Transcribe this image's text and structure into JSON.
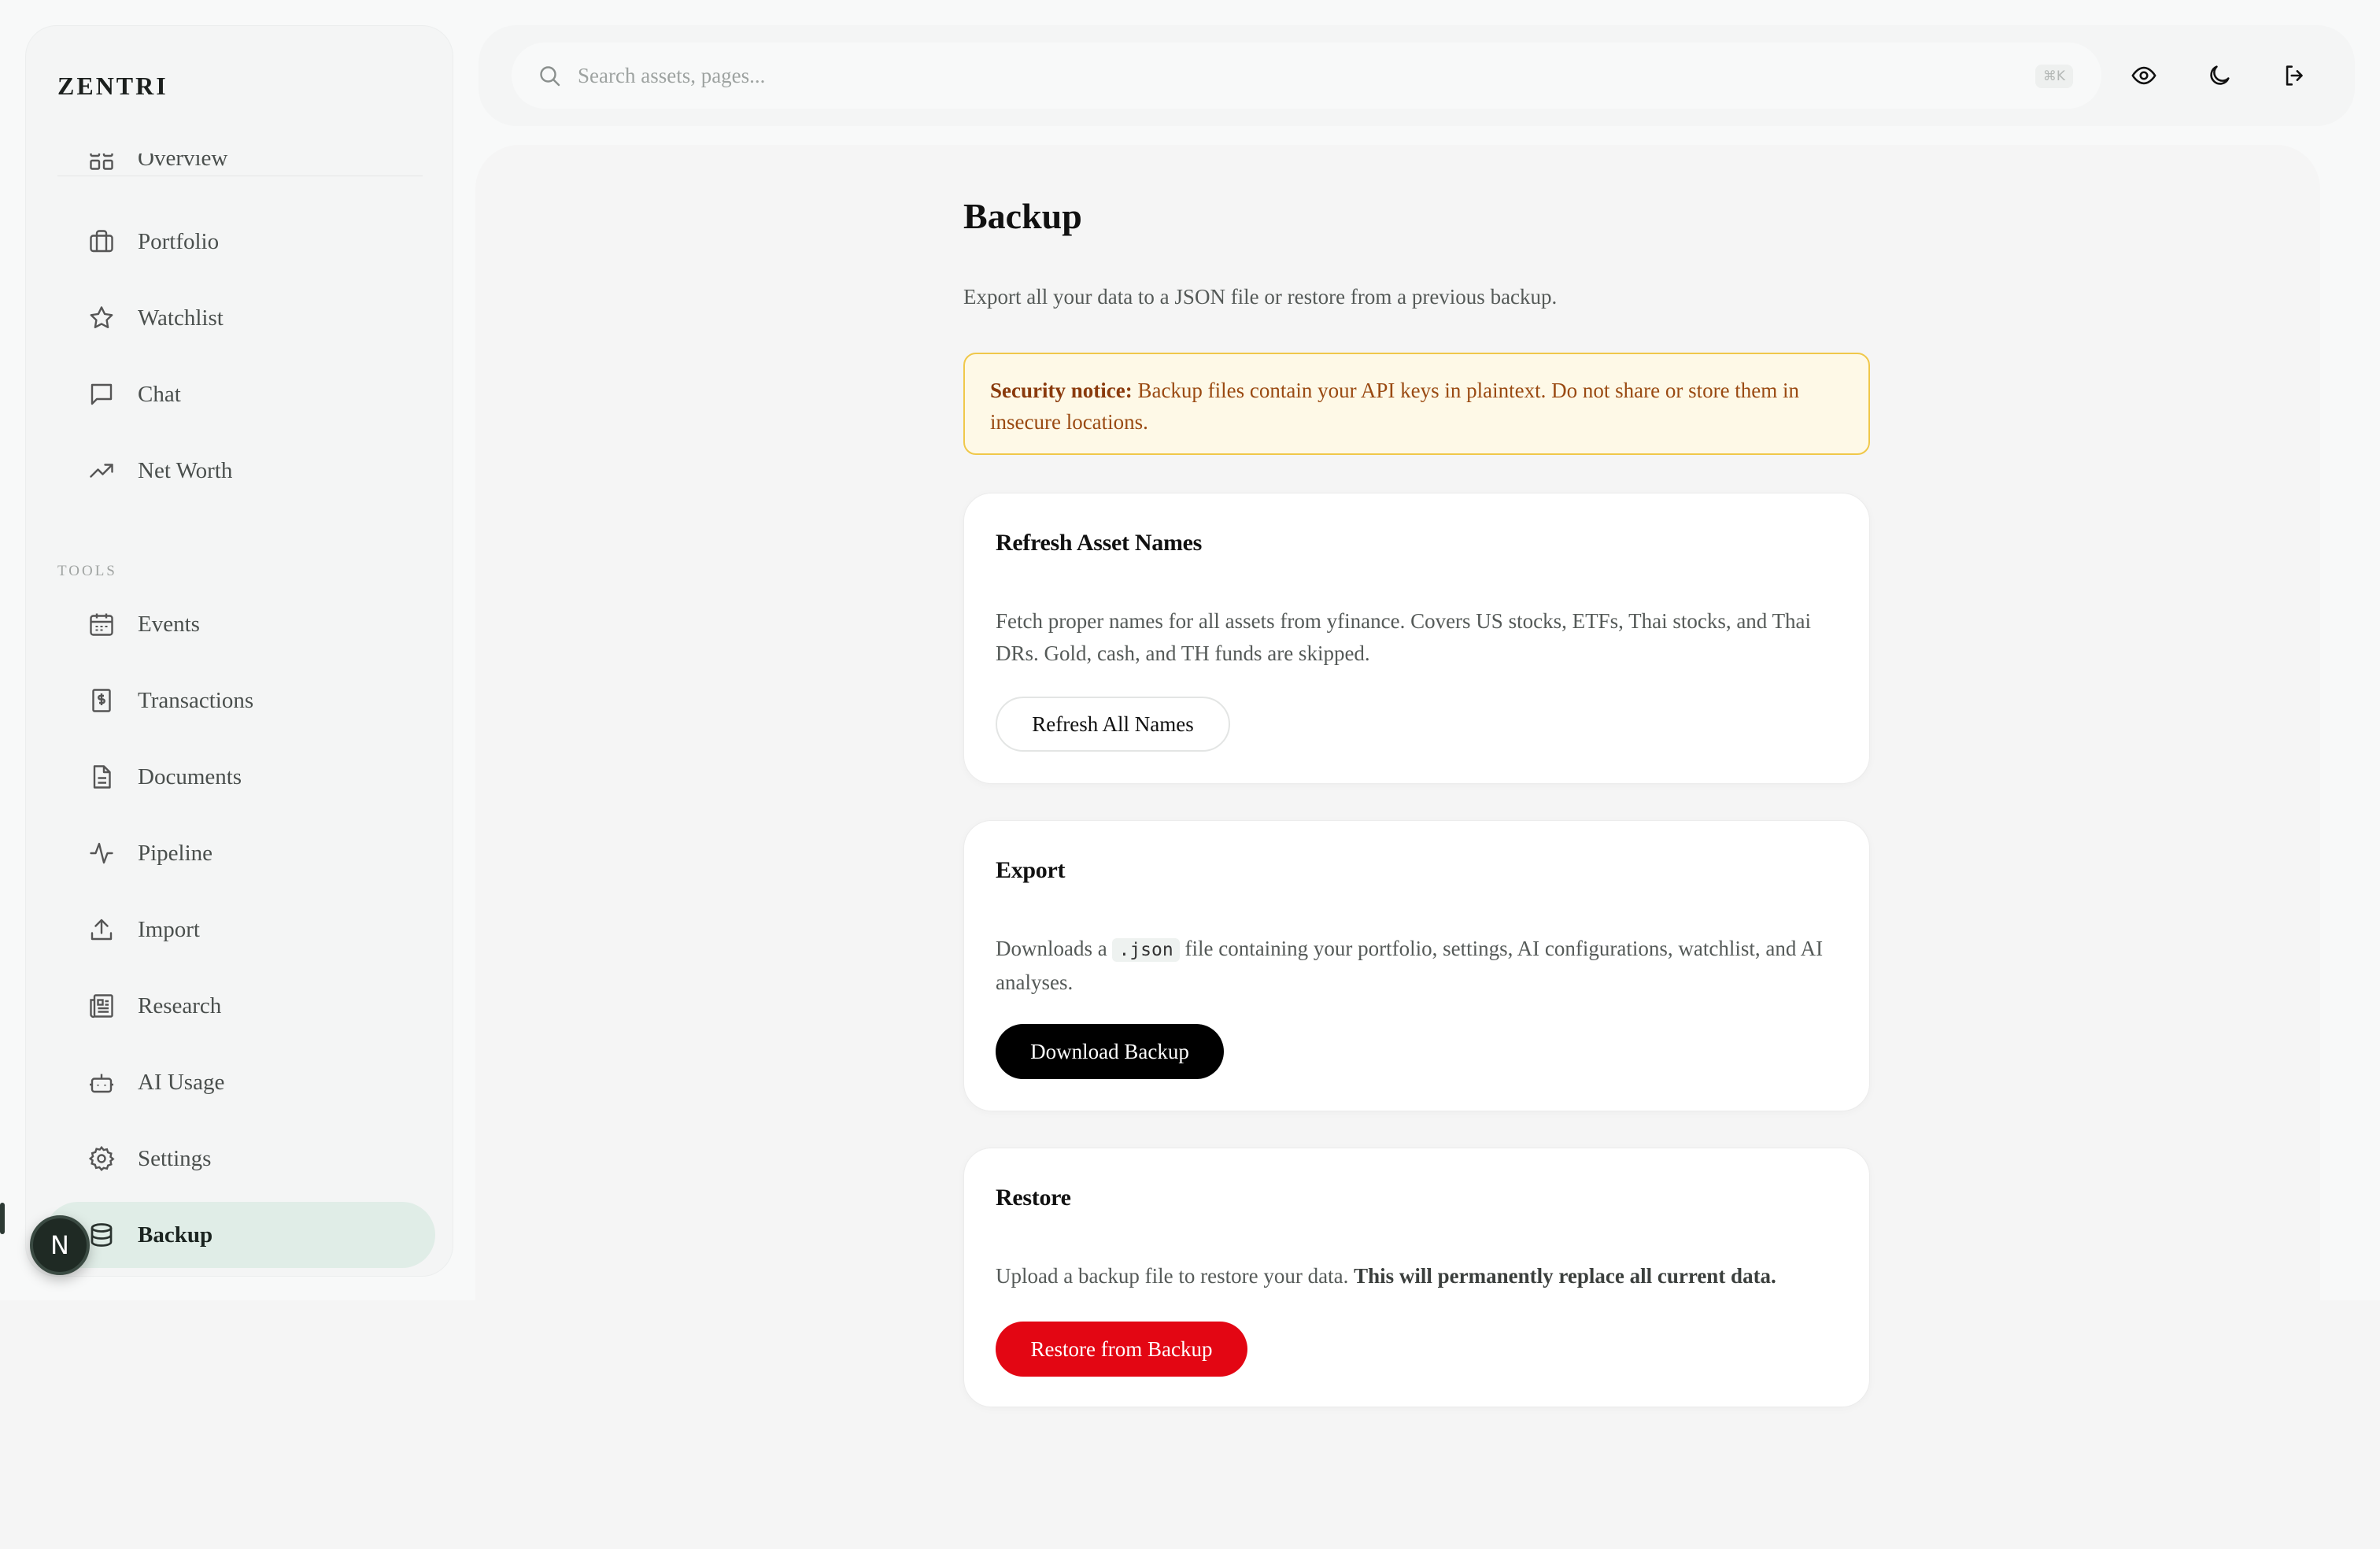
{
  "app": {
    "brand": "ZENTRI"
  },
  "sidebar": {
    "items": [
      {
        "label": "Overview",
        "icon": "grid-icon"
      },
      {
        "label": "Portfolio",
        "icon": "briefcase-icon"
      },
      {
        "label": "Watchlist",
        "icon": "star-icon"
      },
      {
        "label": "Chat",
        "icon": "message-icon"
      },
      {
        "label": "Net Worth",
        "icon": "trending-up-icon"
      }
    ],
    "tools_label": "TOOLS",
    "tools": [
      {
        "label": "Events",
        "icon": "calendar-icon"
      },
      {
        "label": "Transactions",
        "icon": "receipt-icon"
      },
      {
        "label": "Documents",
        "icon": "file-icon"
      },
      {
        "label": "Pipeline",
        "icon": "activity-icon"
      },
      {
        "label": "Import",
        "icon": "upload-icon"
      },
      {
        "label": "Research",
        "icon": "newspaper-icon"
      },
      {
        "label": "AI Usage",
        "icon": "bot-icon"
      },
      {
        "label": "Settings",
        "icon": "gear-icon"
      },
      {
        "label": "Backup",
        "icon": "database-icon",
        "active": true
      }
    ],
    "avatar_letter": "N"
  },
  "topbar": {
    "search_placeholder": "Search assets, pages...",
    "shortcut": "⌘K"
  },
  "page": {
    "title": "Backup",
    "description": "Export all your data to a JSON file or restore from a previous backup.",
    "notice_strong": "Security notice:",
    "notice_text": " Backup files contain your API keys in plaintext. Do not share or store them in insecure locations."
  },
  "cards": {
    "refresh": {
      "title": "Refresh Asset Names",
      "text": "Fetch proper names for all assets from yfinance. Covers US stocks, ETFs, Thai stocks, and Thai DRs. Gold, cash, and TH funds are skipped.",
      "button": "Refresh All Names"
    },
    "export": {
      "title": "Export",
      "text_before": "Downloads a ",
      "code": ".json",
      "text_after": " file containing your portfolio, settings, AI configurations, watchlist, and AI analyses.",
      "button": "Download Backup"
    },
    "restore": {
      "title": "Restore",
      "text": "Upload a backup file to restore your data. ",
      "text_strong": "This will permanently replace all current data.",
      "button": "Restore from Backup"
    }
  },
  "colors": {
    "accent_active_bg": "#e0ede7",
    "notice_bg": "#fef9e7",
    "notice_border": "#f0c84a",
    "danger": "#e30613"
  }
}
